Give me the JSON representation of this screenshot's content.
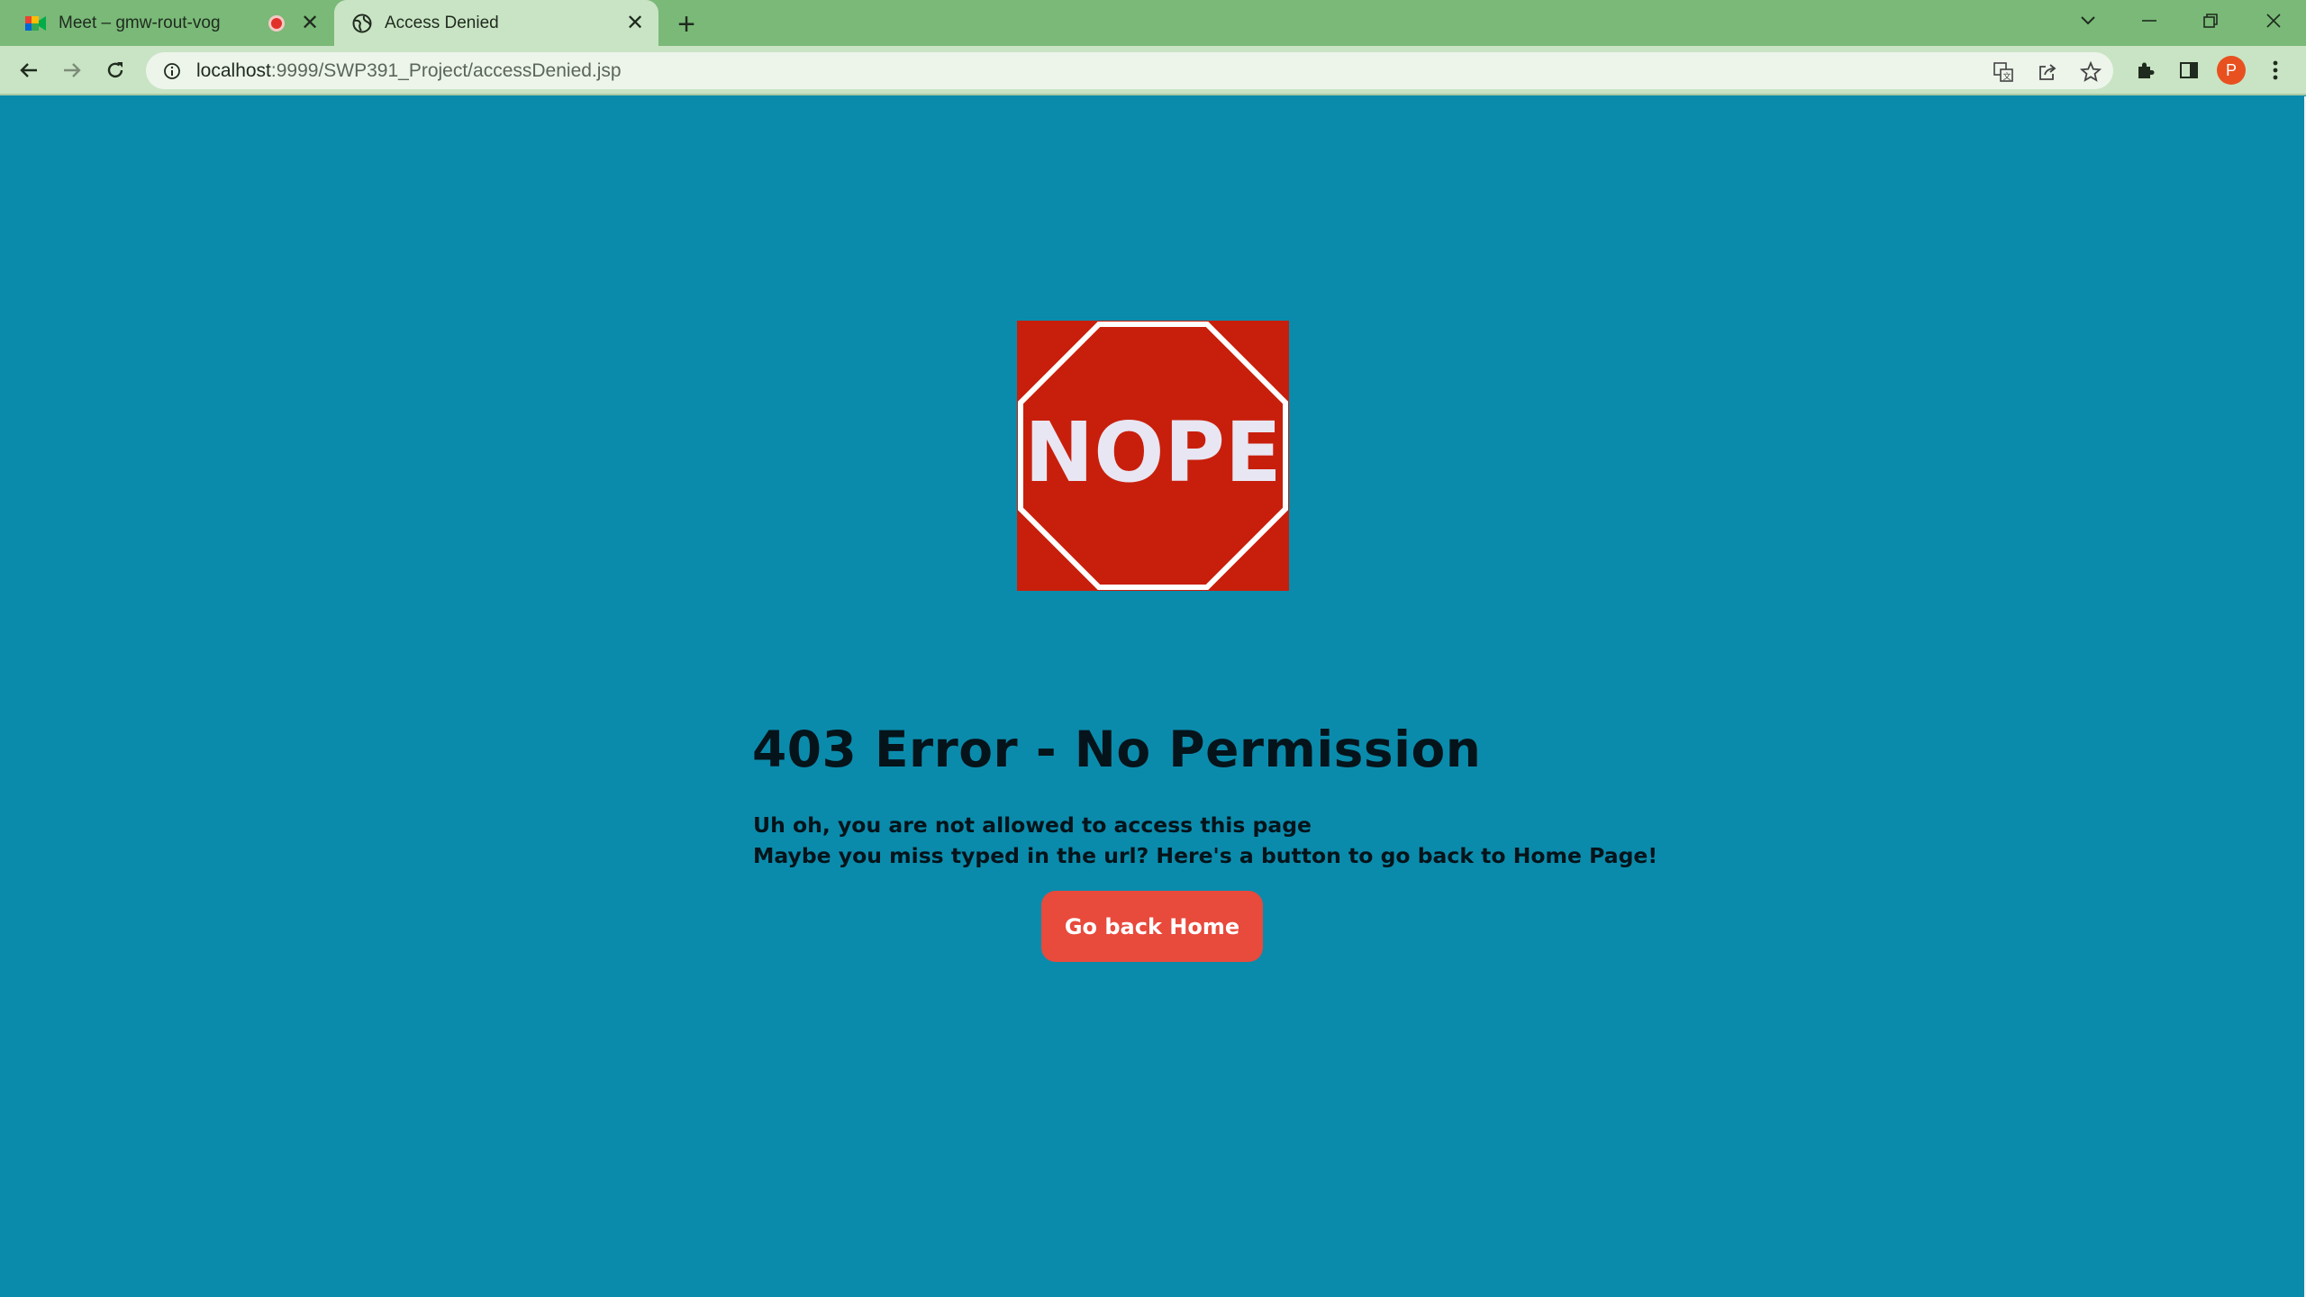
{
  "browser": {
    "tabs": [
      {
        "title": "Meet – gmw-rout-vog",
        "recording": true,
        "active": false
      },
      {
        "title": "Access Denied",
        "active": true
      }
    ],
    "url_host": "localhost",
    "url_path": ":9999/SWP391_Project/accessDenied.jsp",
    "profile_initial": "P"
  },
  "page": {
    "sign_text": "NOPE",
    "title": "403 Error - No Permission",
    "line1": "Uh oh, you are not allowed to access this page",
    "line2": "Maybe you miss typed in the url? Here's a button to go back to Home Page!",
    "button_label": "Go back Home"
  },
  "colors": {
    "background": "#0b8bab",
    "stop_sign": "#c81f0c",
    "button": "#e84a3c",
    "tabstrip": "#7ab978"
  }
}
